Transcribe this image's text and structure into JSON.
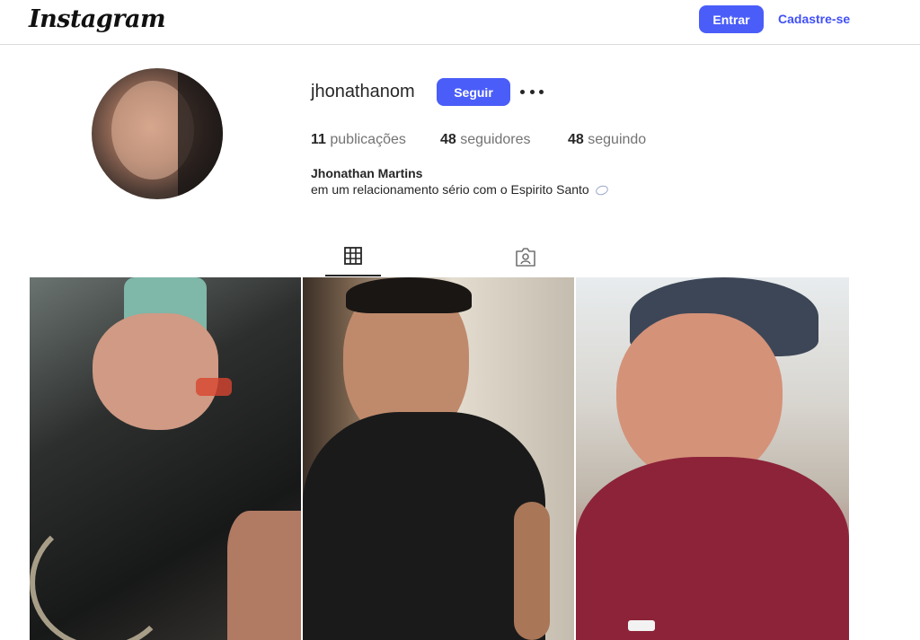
{
  "header": {
    "logo": "Instagram",
    "login_label": "Entrar",
    "signup_label": "Cadastre-se"
  },
  "profile": {
    "username": "jhonathanom",
    "follow_label": "Seguir",
    "stats": {
      "posts_count": "11",
      "posts_label": "publicações",
      "followers_count": "48",
      "followers_label": "seguidores",
      "following_count": "48",
      "following_label": "seguindo"
    },
    "full_name": "Jhonathan Martins",
    "bio": "em um relacionamento sério com o Espirito Santo"
  },
  "tabs": [
    {
      "icon": "grid-icon",
      "active": true
    },
    {
      "icon": "tagged-icon",
      "active": false
    }
  ],
  "posts": [
    {
      "description_icon": "photo"
    },
    {
      "description_icon": "photo"
    },
    {
      "description_icon": "photo"
    }
  ],
  "colors": {
    "accent": "#4a5df9",
    "link": "#4150f7",
    "border": "#dbdbdb"
  }
}
